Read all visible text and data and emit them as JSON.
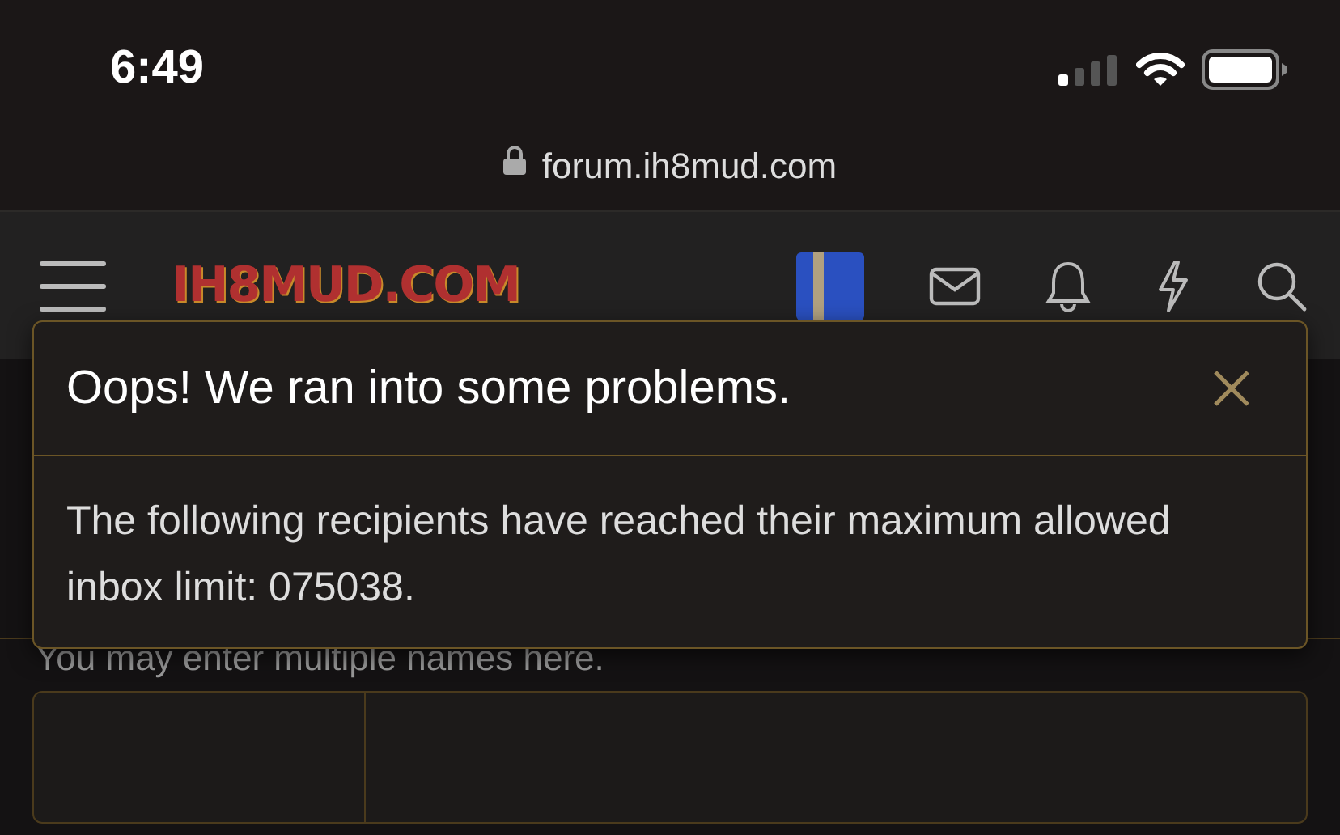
{
  "status_bar": {
    "time": "6:49"
  },
  "address_bar": {
    "url": "forum.ih8mud.com"
  },
  "header": {
    "logo": "IH8MUD.COM"
  },
  "form": {
    "hint": "You may enter multiple names here."
  },
  "dialog": {
    "title": "Oops! We ran into some problems.",
    "message": "The following recipients have reached their maximum allowed inbox limit: 075038."
  }
}
